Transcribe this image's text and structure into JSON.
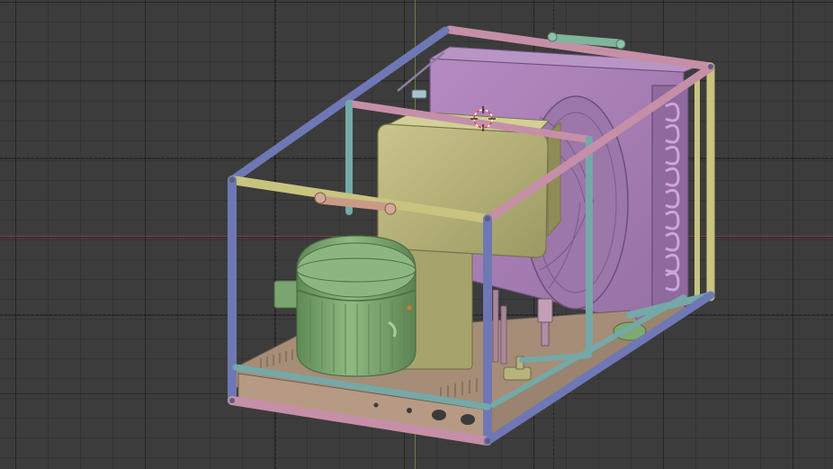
{
  "viewport": {
    "background": "#3c3c3c",
    "axis_x_color": "#be3c3c",
    "axis_y_color": "#8caa3c",
    "cursor_icon": "3d-cursor-crosshair"
  },
  "model": {
    "parts": [
      "frame",
      "radiator-plate",
      "fan",
      "condenser-coil",
      "electrical-box",
      "compressor",
      "base-plate",
      "handles",
      "valves"
    ],
    "colors": {
      "frame_pink": "#c68fa8",
      "frame_blue": "#6f78b5",
      "frame_teal": "#74a9a8",
      "frame_yellow": "#c8c47f",
      "radiator": "#a47bb2",
      "box": "#b5b27a",
      "compressor": "#7fa872",
      "base": "#a58d78"
    }
  }
}
